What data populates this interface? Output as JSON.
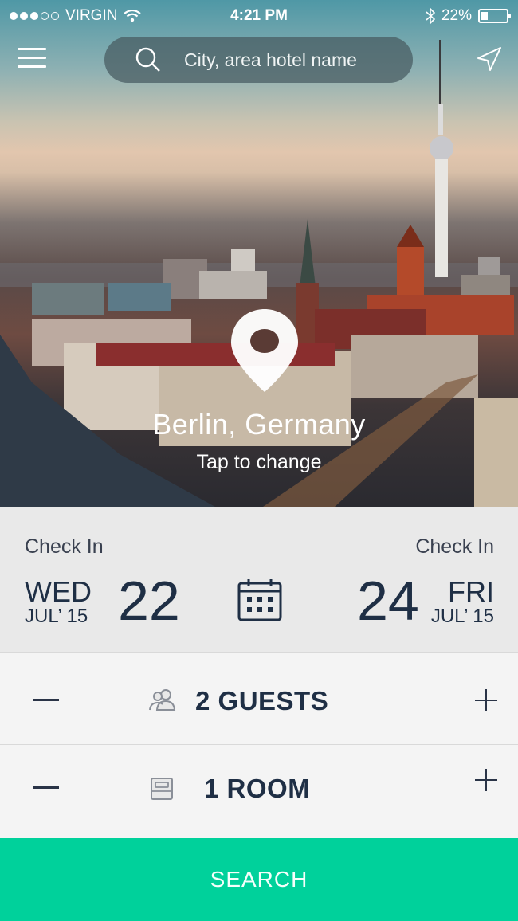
{
  "status_bar": {
    "carrier": "VIRGIN",
    "time": "4:21 PM",
    "battery": "22%",
    "battery_level": 0.22,
    "signal_bars": 3,
    "icons": [
      "signal-dots-icon",
      "wifi-icon",
      "bluetooth-icon",
      "battery-icon"
    ]
  },
  "header": {
    "menu_icon": "hamburger-menu-icon",
    "search_placeholder": "City, area hotel name",
    "search_icon": "search-icon",
    "locate_icon": "location-arrow-icon"
  },
  "hero": {
    "pin_icon": "map-pin-icon",
    "city": "Berlin, Germany",
    "hint": "Tap to change"
  },
  "dates": {
    "check_in": {
      "label": "Check In",
      "weekday": "WED",
      "month": "JUL’ 15",
      "day": "22"
    },
    "check_out": {
      "label": "Check In",
      "weekday": "FRI",
      "month": "JUL’ 15",
      "day": "24"
    },
    "calendar_icon": "calendar-icon"
  },
  "guests": {
    "label": "2 GUESTS",
    "icon": "guests-icon"
  },
  "rooms": {
    "label": "1 ROOM",
    "icon": "bed-icon"
  },
  "search_button": {
    "label": "SEARCH"
  },
  "colors": {
    "accent": "#00d19b",
    "text": "#1f2f45",
    "panel": "#e9e9e9"
  }
}
